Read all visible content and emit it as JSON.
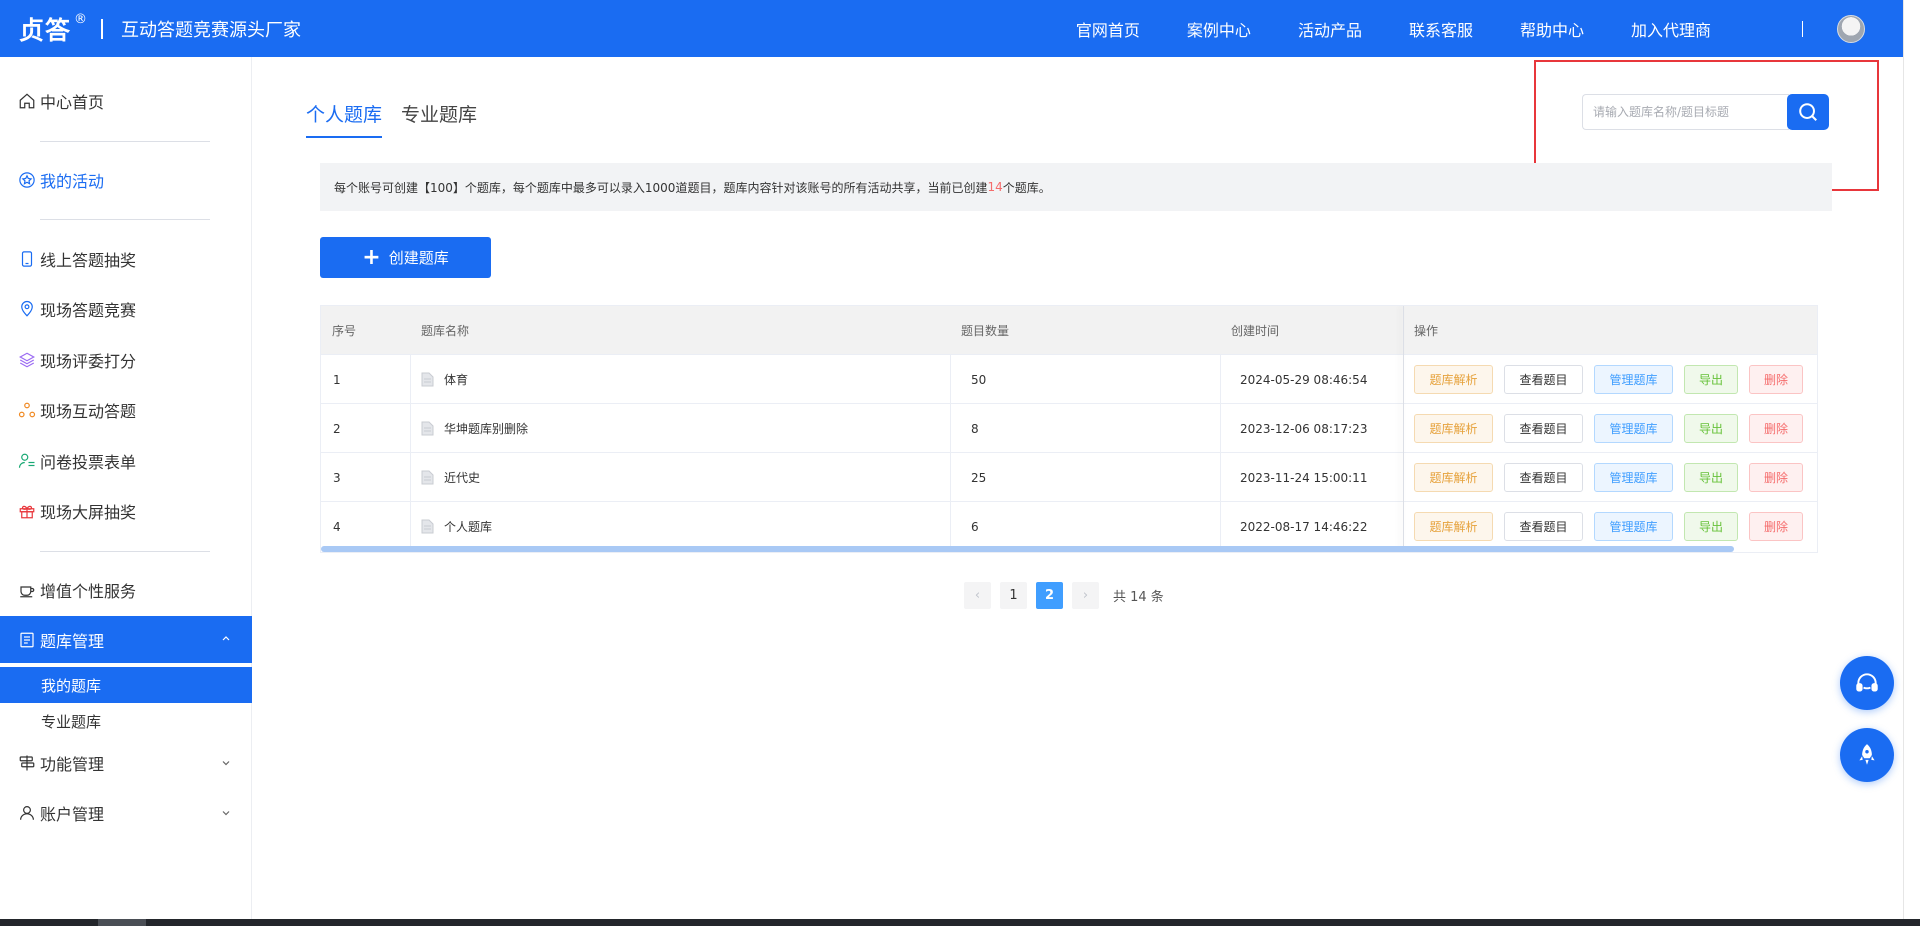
{
  "header": {
    "logo": "贞答",
    "logo_mark": "®",
    "slogan": "互动答题竞赛源头厂家",
    "nav": [
      "官网首页",
      "案例中心",
      "活动产品",
      "联系客服",
      "帮助中心",
      "加入代理商"
    ]
  },
  "sidebar": {
    "home": "中心首页",
    "my_activity": "我的活动",
    "activities": [
      "线上答题抽奖",
      "现场答题竞赛",
      "现场评委打分",
      "现场互动答题",
      "问卷投票表单",
      "现场大屏抽奖"
    ],
    "value_added": "增值个性服务",
    "bank_manage": "题库管理",
    "bank_sub": [
      "我的题库",
      "专业题库"
    ],
    "feature_manage": "功能管理",
    "account_manage": "账户管理"
  },
  "tabs": [
    "个人题库",
    "专业题库"
  ],
  "search": {
    "placeholder": "请输入题库名称/题目标题"
  },
  "notice": {
    "prefix": "每个账号可创建【100】个题库，每个题库中最多可以录入1000道题目，题库内容针对该账号的所有活动共享，当前已创建",
    "count": "14",
    "suffix": "个题库。"
  },
  "create_button": "创建题库",
  "table": {
    "headers": [
      "序号",
      "题库名称",
      "题目数量",
      "创建时间",
      "操作"
    ],
    "rows": [
      {
        "index": "1",
        "name": "体育",
        "count": "50",
        "created": "2024-05-29 08:46:54"
      },
      {
        "index": "2",
        "name": "华坤题库别删除",
        "count": "8",
        "created": "2023-12-06 08:17:23"
      },
      {
        "index": "3",
        "name": "近代史",
        "count": "25",
        "created": "2023-11-24 15:00:11"
      },
      {
        "index": "4",
        "name": "个人题库",
        "count": "6",
        "created": "2022-08-17 14:46:22"
      }
    ],
    "ops": [
      "题库解析",
      "查看题目",
      "管理题库",
      "导出",
      "删除"
    ]
  },
  "pagination": {
    "pages": [
      "1",
      "2"
    ],
    "current": "2",
    "prev": "‹",
    "next": "›",
    "total": "共 14 条"
  },
  "colors": {
    "primary": "#1a6cf2",
    "warning": "#e6a23c",
    "info": "#409eff",
    "success": "#67c23a",
    "danger": "#f56c6c",
    "highlight": "#e8363b"
  }
}
